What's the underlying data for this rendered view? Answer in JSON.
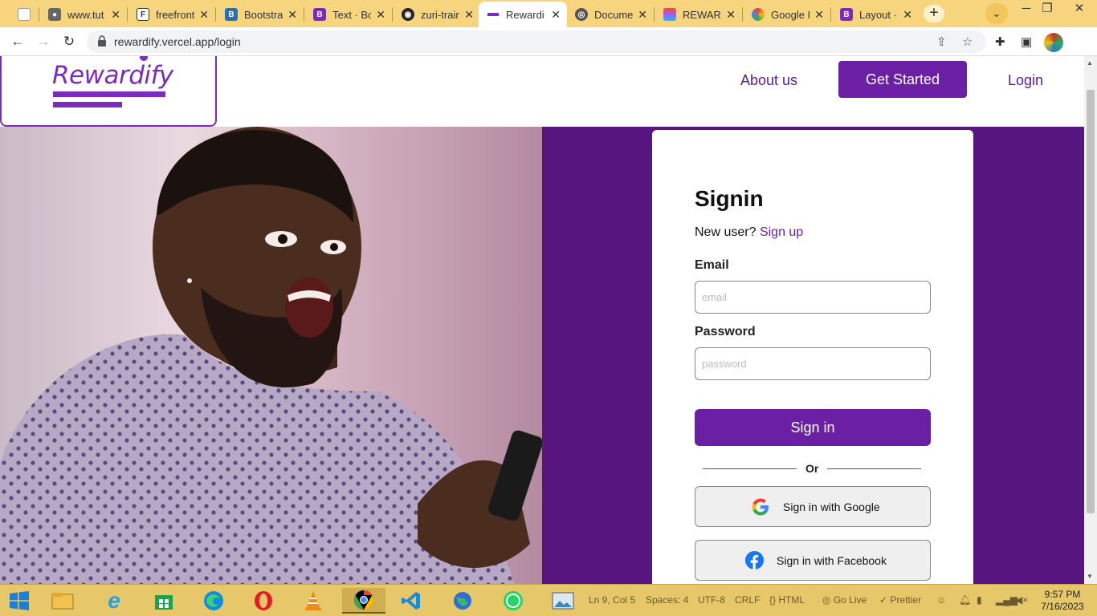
{
  "browser": {
    "tabs": [
      {
        "label": "",
        "close": "✕"
      },
      {
        "label": "www.tut",
        "close": "✕"
      },
      {
        "label": "freefront",
        "close": "✕"
      },
      {
        "label": "Bootstra",
        "close": "✕"
      },
      {
        "label": "Text · Bo",
        "close": "✕"
      },
      {
        "label": "zuri-train",
        "close": "✕"
      },
      {
        "label": "Rewardif",
        "close": "✕"
      },
      {
        "label": "Docume",
        "close": "✕"
      },
      {
        "label": "REWARD",
        "close": "✕"
      },
      {
        "label": "Google I",
        "close": "✕"
      },
      {
        "label": "Layout ·",
        "close": "✕"
      }
    ],
    "url": "rewardify.vercel.app/login",
    "accent": "#f7d57e"
  },
  "site": {
    "logo": "Rewardify",
    "nav": {
      "about": "About us",
      "get_started": "Get Started",
      "login": "Login"
    },
    "brand_color": "#6a1fa5",
    "panel_color": "#56157f"
  },
  "signin": {
    "title": "Signin",
    "new_user": "New user?",
    "signup": "Sign up",
    "email_label": "Email",
    "email_placeholder": "email",
    "password_label": "Password",
    "password_placeholder": "password",
    "submit": "Sign in",
    "or": "Or",
    "google": "Sign in with Google",
    "facebook": "Sign in with Facebook"
  },
  "taskbar": {
    "status": {
      "position": "Ln 9, Col 5",
      "spaces": "Spaces: 4",
      "encoding": "UTF-8",
      "eol": "CRLF",
      "language": "HTML",
      "golive": "Go Live",
      "prettier": "Prettier"
    },
    "time": "9:57 PM",
    "date": "7/16/2023"
  }
}
